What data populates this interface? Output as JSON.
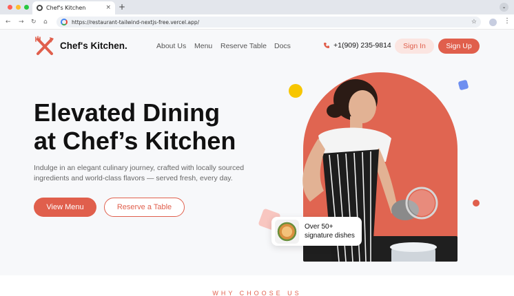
{
  "browser": {
    "tab_title": "Chef's Kitchen",
    "tab_close": "×",
    "new_tab": "+",
    "url": "https://restaurant-tailwind-nextjs-free.vercel.app/",
    "bookmark_icon": "☆",
    "menu_icon": "⋮",
    "dropdown_icon": "⌄",
    "nav": {
      "back": "←",
      "forward": "→",
      "reload": "↻",
      "home": "⌂"
    }
  },
  "header": {
    "brand": "Chef's Kitchen.",
    "nav": [
      "About Us",
      "Menu",
      "Reserve Table",
      "Docs"
    ],
    "phone": "+1(909) 235-9814",
    "signin_label": "Sign In",
    "signup_label": "Sign Up"
  },
  "hero": {
    "title_line1": "Elevated Dining",
    "title_line2": "at Chef’s Kitchen",
    "subtitle_line1": "Indulge in an elegant culinary journey, crafted with locally sourced",
    "subtitle_line2": "ingredients and world-class flavors — served fresh, every day.",
    "cta_primary": "View Menu",
    "cta_secondary": "Reserve a Table",
    "badge_line1": "Over 50+",
    "badge_line2": "signature dishes"
  },
  "section": {
    "eyebrow": "WHY CHOOSE US"
  },
  "colors": {
    "accent": "#e05f4c",
    "accent_light": "#fbe5e1",
    "yellow": "#f7c600",
    "blue": "#6e8ff0",
    "pink": "#f8c6c0"
  },
  "icons": {
    "logo": "fork-knife-cross-icon",
    "phone": "phone-icon",
    "favicon": "chrome-icon"
  }
}
